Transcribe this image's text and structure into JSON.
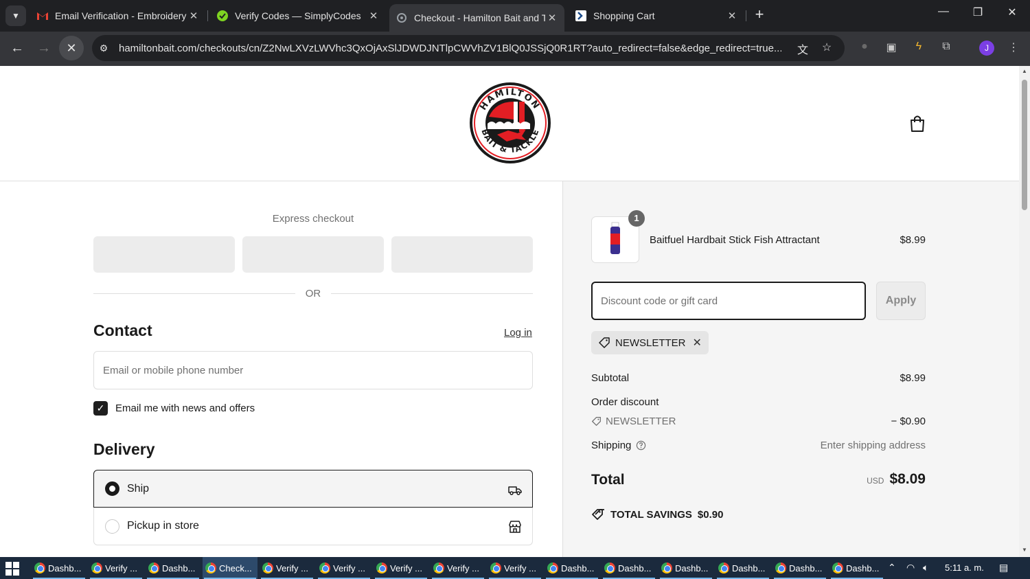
{
  "browser": {
    "tabs": [
      {
        "title": "Email Verification - Embroidery",
        "icon": "gmail-icon"
      },
      {
        "title": "Verify Codes — SimplyCodes",
        "icon": "simplycodes-icon"
      },
      {
        "title": "Checkout - Hamilton Bait and Ta",
        "icon": "loading-icon",
        "active": true
      },
      {
        "title": "Shopping Cart",
        "icon": "site-icon"
      }
    ],
    "url": "hamiltonbait.com/checkouts/cn/Z2NwLXVzLWVhc3QxOjAxSlJDWDJNTlpCWVhZV1BlQ0JSSjQ0R1RT?auto_redirect=false&edge_redirect=true...",
    "profile_initial": "J"
  },
  "checkout": {
    "express_title": "Express checkout",
    "or_text": "OR",
    "contact": {
      "title": "Contact",
      "login_link": "Log in",
      "email_placeholder": "Email or mobile phone number",
      "newsletter_label": "Email me with news and offers",
      "newsletter_checked": true
    },
    "delivery": {
      "title": "Delivery",
      "options": [
        {
          "label": "Ship",
          "selected": true,
          "icon": "truck-icon"
        },
        {
          "label": "Pickup in store",
          "selected": false,
          "icon": "store-icon"
        }
      ]
    }
  },
  "summary": {
    "product": {
      "name": "Baitfuel Hardbait Stick Fish Attractant",
      "price": "$8.99",
      "quantity": "1"
    },
    "discount_placeholder": "Discount code or gift card",
    "apply_label": "Apply",
    "applied_code": "NEWSLETTER",
    "subtotal_label": "Subtotal",
    "subtotal_value": "$8.99",
    "order_discount_label": "Order discount",
    "discount_code": "NEWSLETTER",
    "discount_value": "− $0.90",
    "shipping_label": "Shipping",
    "shipping_value": "Enter shipping address",
    "total_label": "Total",
    "total_currency": "USD",
    "total_value": "$8.09",
    "savings_label": "TOTAL SAVINGS",
    "savings_value": "$0.90"
  },
  "taskbar": {
    "items": [
      {
        "label": "Dashb..."
      },
      {
        "label": "Verify ..."
      },
      {
        "label": "Dashb..."
      },
      {
        "label": "Check...",
        "active": true
      },
      {
        "label": "Verify ..."
      },
      {
        "label": "Verify ..."
      },
      {
        "label": "Verify ..."
      },
      {
        "label": "Verify ..."
      },
      {
        "label": "Verify ..."
      },
      {
        "label": "Dashb..."
      },
      {
        "label": "Dashb..."
      },
      {
        "label": "Dashb..."
      },
      {
        "label": "Dashb..."
      },
      {
        "label": "Dashb..."
      },
      {
        "label": "Dashb..."
      }
    ],
    "clock": "5:11 a. m."
  },
  "colors": {
    "accent": "#1a1a1a",
    "summary_bg": "#f5f5f5",
    "brand_red": "#e31e24"
  }
}
